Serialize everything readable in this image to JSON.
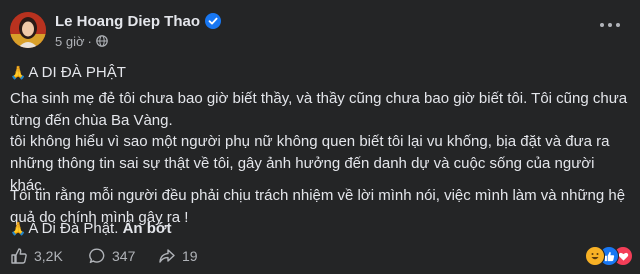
{
  "post": {
    "author": "Le Hoang Diep Thao",
    "time": "5 giờ",
    "paragraphs": [
      {
        "prefix_emoji": "🙏",
        "text": " A DI ĐÀ PHẬT"
      },
      {
        "text": "Cha sinh mẹ đẻ tôi chưa bao giờ biết thầy, và thầy cũng chưa bao giờ biết tôi. Tôi cũng chưa từng đến chùa Ba Vàng."
      },
      {
        "text": "tôi không hiểu vì sao một người phụ nữ không quen biết tôi lại vu khống, bịa đặt và đưa ra những thông tin sai sự thật về tôi, gây ảnh hưởng đến danh dự và cuộc sống của người khác."
      },
      {
        "text": "Tôi tin rằng mỗi người đều phải chịu trách nhiệm về lời mình nói, việc mình làm và những hệ quả do chính mình gây ra !"
      },
      {
        "prefix_emoji": "🙏",
        "text": " A Di Đà Phật. ",
        "show_less": "Ẩn bớt"
      }
    ]
  },
  "footer": {
    "likes": "3,2K",
    "comments": "347",
    "shares": "19"
  },
  "colors": {
    "background": "#242526",
    "text": "#e4e6eb",
    "secondary_text": "#b0b3b8",
    "verified_blue": "#1877f2"
  },
  "icons": [
    "verified-badge-icon",
    "globe-icon",
    "more-options-icon",
    "like-icon",
    "comment-icon",
    "share-icon",
    "haha-reaction-icon",
    "like-reaction-icon",
    "love-reaction-icon"
  ]
}
